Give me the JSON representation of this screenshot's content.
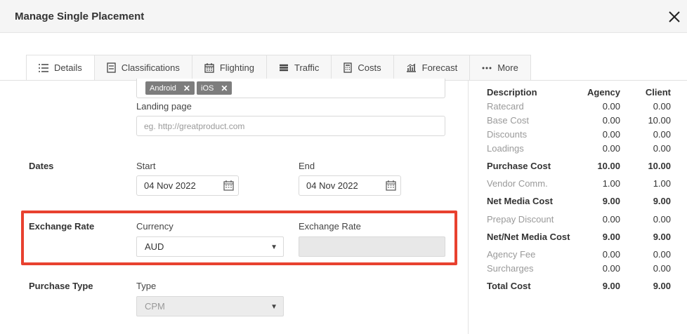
{
  "dialog": {
    "title": "Manage Single Placement"
  },
  "tabs": [
    {
      "label": "Details",
      "icon": "list-icon"
    },
    {
      "label": "Classifications",
      "icon": "document-icon"
    },
    {
      "label": "Flighting",
      "icon": "calendar-icon"
    },
    {
      "label": "Traffic",
      "icon": "stack-icon"
    },
    {
      "label": "Costs",
      "icon": "calculator-icon"
    },
    {
      "label": "Forecast",
      "icon": "chart-icon"
    },
    {
      "label": "More",
      "icon": "ellipsis-icon"
    }
  ],
  "platforms": {
    "tags": [
      "Android",
      "iOS"
    ]
  },
  "landing_page": {
    "label": "Landing page",
    "placeholder": "eg. http://greatproduct.com"
  },
  "dates": {
    "label": "Dates",
    "start_label": "Start",
    "start_value": "04 Nov 2022",
    "end_label": "End",
    "end_value": "04 Nov 2022"
  },
  "exchange": {
    "label": "Exchange Rate",
    "currency_label": "Currency",
    "currency_value": "AUD",
    "rate_label": "Exchange Rate",
    "rate_value": ""
  },
  "purchase": {
    "label": "Purchase Type",
    "type_label": "Type",
    "type_value": "CPM"
  },
  "costs": {
    "headers": {
      "description": "Description",
      "agency": "Agency",
      "client": "Client"
    },
    "rows": [
      {
        "description": "Ratecard",
        "agency": "0.00",
        "client": "0.00",
        "style": "muted"
      },
      {
        "description": "Base Cost",
        "agency": "0.00",
        "client": "10.00",
        "style": "muted"
      },
      {
        "description": "Discounts",
        "agency": "0.00",
        "client": "0.00",
        "style": "muted"
      },
      {
        "description": "Loadings",
        "agency": "0.00",
        "client": "0.00",
        "style": "muted"
      },
      {
        "description": "Purchase Cost",
        "agency": "10.00",
        "client": "10.00",
        "style": "bold"
      },
      {
        "description": "Vendor Comm.",
        "agency": "1.00",
        "client": "1.00",
        "style": "muted"
      },
      {
        "description": "Net Media Cost",
        "agency": "9.00",
        "client": "9.00",
        "style": "bold"
      },
      {
        "description": "Prepay Discount",
        "agency": "0.00",
        "client": "0.00",
        "style": "muted"
      },
      {
        "description": "Net/Net Media Cost",
        "agency": "9.00",
        "client": "9.00",
        "style": "bold"
      },
      {
        "description": "Agency Fee",
        "agency": "0.00",
        "client": "0.00",
        "style": "muted"
      },
      {
        "description": "Surcharges",
        "agency": "0.00",
        "client": "0.00",
        "style": "muted"
      },
      {
        "description": "Total Cost",
        "agency": "9.00",
        "client": "9.00",
        "style": "bold"
      }
    ]
  },
  "colors": {
    "highlight": "#e8412f",
    "header_bg": "#f5f5f5"
  }
}
